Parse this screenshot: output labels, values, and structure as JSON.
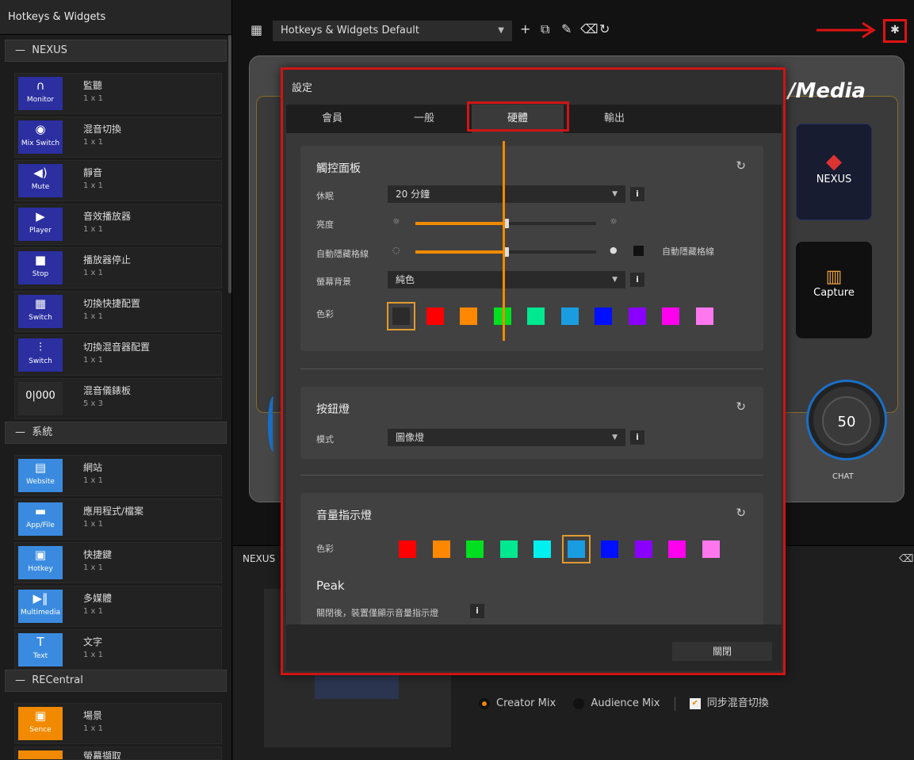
{
  "sidebar": {
    "title": "Hotkeys & Widgets",
    "sections": [
      {
        "label": "NEXUS"
      },
      {
        "label": "系統"
      },
      {
        "label": "RECentral"
      }
    ],
    "widgets": [
      {
        "name": "監聽",
        "size": "1 x 1",
        "icon": "headphones-icon",
        "symbol": "∩",
        "label": "Monitor"
      },
      {
        "name": "混音切換",
        "size": "1 x 1",
        "icon": "mix-switch-icon",
        "symbol": "◉",
        "label": "Mix Switch"
      },
      {
        "name": "靜音",
        "size": "1 x 1",
        "icon": "speaker-mute-icon",
        "symbol": "◀)",
        "label": "Mute"
      },
      {
        "name": "音效播放器",
        "size": "1 x 1",
        "icon": "player-icon",
        "symbol": "▶",
        "label": "Player"
      },
      {
        "name": "播放器停止",
        "size": "1 x 1",
        "icon": "stop-icon",
        "symbol": "■",
        "label": "Stop"
      },
      {
        "name": "切換快捷配置",
        "size": "1 x 1",
        "icon": "switch-grid-icon",
        "symbol": "▦",
        "label": "Switch"
      },
      {
        "name": "切換混音器配置",
        "size": "1 x 1",
        "icon": "switch-mixer-icon",
        "symbol": "⫶",
        "label": "Switch"
      },
      {
        "name": "混音儀錶板",
        "size": "5 x 3",
        "icon": "mixer-dashboard-icon",
        "symbol": "0|000",
        "label": ""
      },
      {
        "name": "網站",
        "size": "1 x 1",
        "icon": "website-icon",
        "symbol": "▤",
        "label": "Website"
      },
      {
        "name": "應用程式/檔案",
        "size": "1 x 1",
        "icon": "app-file-icon",
        "symbol": "▬",
        "label": "App/File"
      },
      {
        "name": "快捷鍵",
        "size": "1 x 1",
        "icon": "hotkey-icon",
        "symbol": "▣",
        "label": "Hotkey"
      },
      {
        "name": "多媒體",
        "size": "1 x 1",
        "icon": "multimedia-icon",
        "symbol": "▶‖",
        "label": "Multimedia"
      },
      {
        "name": "文字",
        "size": "1 x 1",
        "icon": "text-icon",
        "symbol": "T",
        "label": "Text"
      },
      {
        "name": "場景",
        "size": "1 x 1",
        "icon": "scene-icon",
        "symbol": "▣",
        "label": "Sence"
      },
      {
        "name": "螢幕擷取",
        "size": "",
        "icon": "screen-capture-icon",
        "symbol": "",
        "label": ""
      }
    ]
  },
  "topbar": {
    "profile": "Hotkeys & Widgets Default"
  },
  "device": {
    "brand": "Media",
    "buttons": [
      {
        "label": "NEXUS"
      },
      {
        "label": "Capture"
      }
    ],
    "knob_value": "50",
    "knob_label": "CHAT"
  },
  "bottom": {
    "nexus": "NEXUS",
    "mix": {
      "creator": "Creator Mix",
      "audience": "Audience Mix",
      "sync": "同步混音切換"
    }
  },
  "modal": {
    "title": "設定",
    "tabs": [
      {
        "label": "會員"
      },
      {
        "label": "一般"
      },
      {
        "label": "硬體"
      },
      {
        "label": "輸出"
      }
    ],
    "touch_panel": {
      "title": "觸控面板",
      "sleep_label": "休眠",
      "sleep_value": "20 分鐘",
      "brightness_label": "亮度",
      "brightness_level": 0.5,
      "autohide_label": "自動隱藏格線",
      "autohide_level": 0.5,
      "autohide_check_label": "自動隱藏格線",
      "bg_label": "螢幕背景",
      "bg_value": "純色",
      "color_label": "色彩",
      "colors": [
        "#2b2b2b",
        "#ff0000",
        "#ff8800",
        "#00e020",
        "#00e890",
        "#1a9de0",
        "#0010ff",
        "#8a00ff",
        "#ff00ee",
        "#ff77ee"
      ],
      "selected_color": 0
    },
    "button_light": {
      "title": "按鈕燈",
      "mode_label": "模式",
      "mode_value": "圖像燈"
    },
    "volume_light": {
      "title": "音量指示燈",
      "color_label": "色彩",
      "colors": [
        "#ff0000",
        "#ff8800",
        "#00e020",
        "#00e890",
        "#00f0f0",
        "#1a9de0",
        "#0010ff",
        "#8a00ff",
        "#ff00ee",
        "#ff77ee"
      ],
      "selected_color": 5,
      "peak_title": "Peak",
      "peak_desc": "關閉後，裝置僅顯示音量指示燈"
    },
    "close_label": "關閉"
  }
}
